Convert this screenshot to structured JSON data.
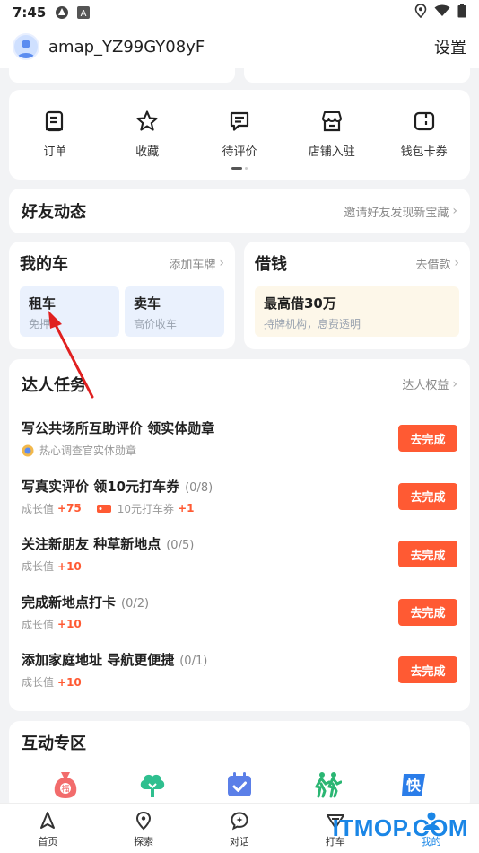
{
  "status_bar": {
    "time": "7:45"
  },
  "header": {
    "username": "amap_YZ99GY08yF",
    "settings_label": "设置"
  },
  "quick_actions": [
    {
      "label": "订单",
      "icon": "order-icon"
    },
    {
      "label": "收藏",
      "icon": "star-icon"
    },
    {
      "label": "待评价",
      "icon": "comment-icon"
    },
    {
      "label": "店铺入驻",
      "icon": "store-icon"
    },
    {
      "label": "钱包卡券",
      "icon": "wallet-icon"
    }
  ],
  "friends": {
    "title": "好友动态",
    "link": "邀请好友发现新宝藏"
  },
  "my_car": {
    "title": "我的车",
    "link": "添加车牌",
    "tiles": [
      {
        "title": "租车",
        "subtitle": "免押"
      },
      {
        "title": "卖车",
        "subtitle": "高价收车"
      }
    ]
  },
  "loan": {
    "title": "借钱",
    "link": "去借款",
    "tile_title": "最高借30万",
    "tile_subtitle": "持牌机构，息费透明"
  },
  "tasks": {
    "title": "达人任务",
    "link": "达人权益",
    "button_label": "去完成",
    "items": [
      {
        "name": "写公共场所互助评价 领实体勋章",
        "count": "",
        "sub": "热心调查官实体勋章",
        "growth_label": "",
        "growth_value": "",
        "extra_label": "",
        "extra_value": ""
      },
      {
        "name": "写真实评价 领10元打车券",
        "count": "(0/8)",
        "sub": "",
        "growth_label": "成长值",
        "growth_value": "+75",
        "extra_label": "10元打车券",
        "extra_value": "+1"
      },
      {
        "name": "关注新朋友 种草新地点",
        "count": "(0/5)",
        "sub": "",
        "growth_label": "成长值",
        "growth_value": "+10",
        "extra_label": "",
        "extra_value": ""
      },
      {
        "name": "完成新地点打卡",
        "count": "(0/2)",
        "sub": "",
        "growth_label": "成长值",
        "growth_value": "+10",
        "extra_label": "",
        "extra_value": ""
      },
      {
        "name": "添加家庭地址 导航更便捷",
        "count": "(0/1)",
        "sub": "",
        "growth_label": "成长值",
        "growth_value": "+10",
        "extra_label": "",
        "extra_value": ""
      }
    ]
  },
  "interact": {
    "title": "互动专区"
  },
  "tabbar": [
    {
      "label": "首页",
      "icon": "navigation-icon"
    },
    {
      "label": "探索",
      "icon": "location-pin-icon"
    },
    {
      "label": "对话",
      "icon": "chat-icon"
    },
    {
      "label": "打车",
      "icon": "taxi-icon"
    },
    {
      "label": "我的",
      "icon": "user-icon"
    }
  ],
  "watermark": "ITMOP.COM",
  "colors": {
    "accent": "#ff5a33",
    "brand_blue": "#1a86e6",
    "background": "#f2f3f5"
  }
}
